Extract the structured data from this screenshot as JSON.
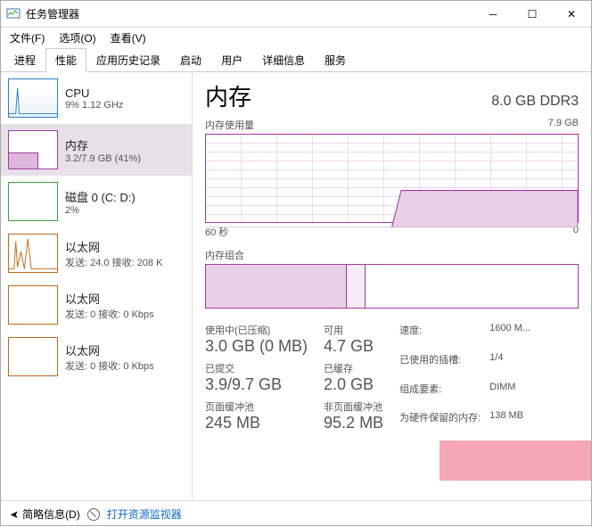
{
  "window": {
    "title": "任务管理器"
  },
  "menu": {
    "file": "文件(F)",
    "options": "选项(O)",
    "view": "查看(V)"
  },
  "tabs": [
    "进程",
    "性能",
    "应用历史记录",
    "启动",
    "用户",
    "详细信息",
    "服务"
  ],
  "activeTab": 1,
  "sidebar": {
    "items": [
      {
        "title": "CPU",
        "sub": "9% 1.12 GHz",
        "kind": "cpu"
      },
      {
        "title": "内存",
        "sub": "3.2/7.9 GB (41%)",
        "kind": "mem",
        "selected": true
      },
      {
        "title": "磁盘 0 (C: D:)",
        "sub": "2%",
        "kind": "disk"
      },
      {
        "title": "以太网",
        "sub": "发送: 24.0 接收: 208 K",
        "kind": "eth",
        "spark": true
      },
      {
        "title": "以太网",
        "sub": "发送: 0 接收: 0 Kbps",
        "kind": "eth"
      },
      {
        "title": "以太网",
        "sub": "发送: 0 接收: 0 Kbps",
        "kind": "eth"
      }
    ]
  },
  "memory": {
    "heading": "内存",
    "spec": "8.0 GB DDR3",
    "graph_title": "内存使用量",
    "graph_max": "7.9 GB",
    "x_left": "60 秒",
    "x_right": "0",
    "comp_title": "内存组合",
    "stats": {
      "inuse_lbl": "使用中(已压缩)",
      "inuse_val": "3.0 GB (0 MB)",
      "avail_lbl": "可用",
      "avail_val": "4.7 GB",
      "commit_lbl": "已提交",
      "commit_val": "3.9/9.7 GB",
      "cached_lbl": "已缓存",
      "cached_val": "2.0 GB",
      "paged_lbl": "页面缓冲池",
      "paged_val": "245 MB",
      "nonpaged_lbl": "非页面缓冲池",
      "nonpaged_val": "95.2 MB"
    },
    "kv": {
      "speed_lbl": "速度:",
      "speed_val": "1600 M...",
      "slots_lbl": "已使用的插槽:",
      "slots_val": "1/4",
      "form_lbl": "组成要素:",
      "form_val": "DIMM",
      "hw_lbl": "为硬件保留的内存:",
      "hw_val": "138 MB"
    }
  },
  "footer": {
    "less": "简略信息(D)",
    "open": "打开资源监视器"
  },
  "chart_data": {
    "type": "line",
    "title": "内存使用量",
    "xlabel": "60 秒 → 0",
    "ylabel": "GB",
    "ylim": [
      0,
      7.9
    ],
    "x": [
      60,
      55,
      50,
      45,
      40,
      35,
      30,
      25,
      20,
      15,
      10,
      5,
      0
    ],
    "values": [
      0,
      0,
      0,
      0,
      0,
      0,
      3.2,
      3.2,
      3.2,
      3.2,
      3.2,
      3.2,
      3.2
    ]
  }
}
